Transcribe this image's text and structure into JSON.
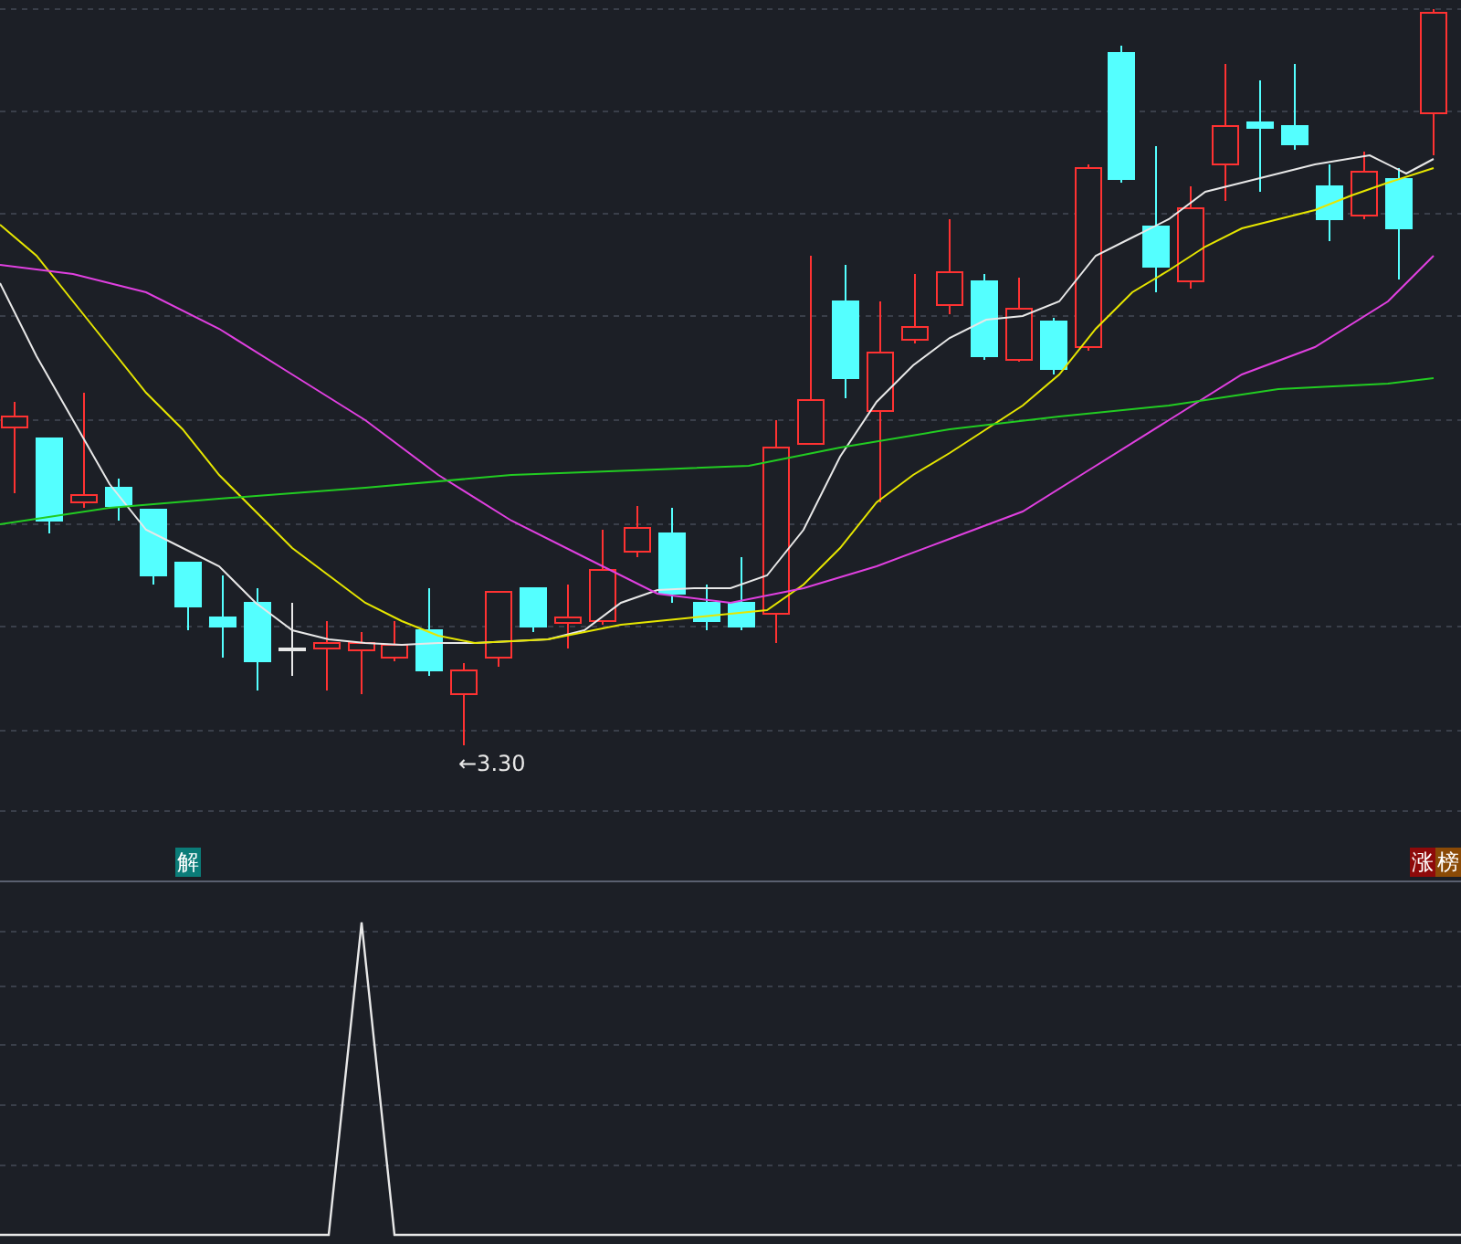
{
  "price_chart": {
    "low_marker": "←3.30"
  },
  "left_badges": [
    {
      "label": "解",
      "color": "#0b7c78"
    }
  ],
  "right_badges": [
    {
      "label": "涨",
      "color": "#8e0a0a"
    },
    {
      "label": "榜",
      "color": "#8a4a06"
    }
  ]
}
